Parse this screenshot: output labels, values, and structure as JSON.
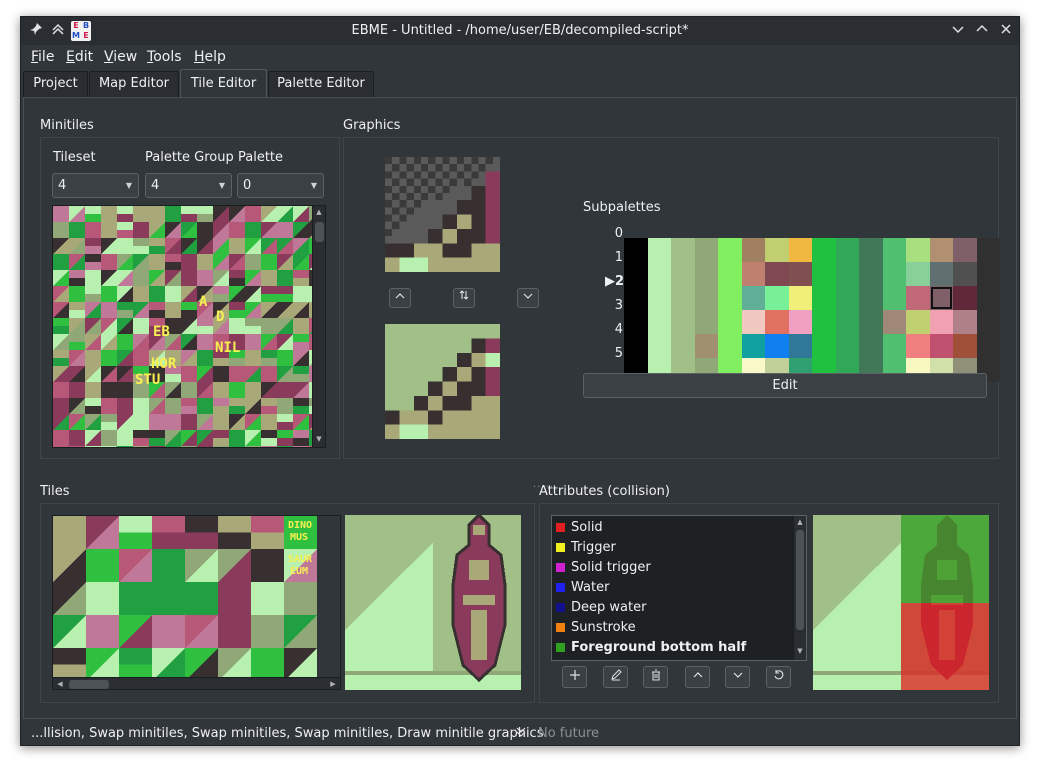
{
  "window": {
    "title": "EBME - Untitled - /home/user/EB/decompiled-script*",
    "logo_letters": [
      "E",
      "B",
      "M",
      "E"
    ]
  },
  "menu": [
    "File",
    "Edit",
    "View",
    "Tools",
    "Help"
  ],
  "menu_underline": [
    "F",
    "E",
    "V",
    "T",
    "H"
  ],
  "tabs": [
    "Project",
    "Map Editor",
    "Tile Editor",
    "Palette Editor"
  ],
  "active_tab": "Tile Editor",
  "minitiles": {
    "group_title": "Minitiles",
    "tileset_label": "Tileset",
    "tileset_value": "4",
    "palette_group_label": "Palette Group",
    "palette_group_value": "4",
    "palette_label": "Palette",
    "palette_value": "0",
    "overlay_text": [
      "A",
      "D",
      "EB",
      "NIL",
      "HOR",
      "STU"
    ]
  },
  "graphics": {
    "group_title": "Graphics",
    "buttons": [
      "up-icon",
      "swap-icon",
      "down-icon"
    ]
  },
  "subpalettes": {
    "title": "Subpalettes",
    "row_labels": [
      "0",
      "1",
      "2",
      "3",
      "4",
      "5"
    ],
    "selected_row": 2,
    "selected_col": 14,
    "rows": [
      [
        "#000000",
        "#b8f0b0",
        "#a0c088",
        "#90a878",
        "#80f060",
        "#a08060",
        "#c0d070",
        "#f0b840",
        "#20c040",
        "#30a858",
        "#407858",
        "#50c070",
        "#a8e080",
        "#b09070",
        "#806068",
        "#303030"
      ],
      [
        "#000000",
        "#b8f0b0",
        "#a0c088",
        "#90a878",
        "#80f060",
        "#c08070",
        "#804850",
        "#805050",
        "#20c040",
        "#30a858",
        "#407858",
        "#50c070",
        "#88d098",
        "#607070",
        "#505050",
        "#303030"
      ],
      [
        "#000000",
        "#b8f0b0",
        "#a0c088",
        "#90a878",
        "#80f060",
        "#60b098",
        "#78f098",
        "#f0f078",
        "#20c040",
        "#30a858",
        "#407858",
        "#50c070",
        "#c06878",
        "#806068",
        "#602838",
        "#303030"
      ],
      [
        "#000000",
        "#b8f0b0",
        "#a0c088",
        "#90a878",
        "#80f060",
        "#f0c8c0",
        "#e07060",
        "#f0a0c0",
        "#20c040",
        "#30a858",
        "#407858",
        "#a08878",
        "#c0d070",
        "#f0a0b0",
        "#b08088",
        "#303030"
      ],
      [
        "#000000",
        "#b8f0b0",
        "#a0c088",
        "#a09070",
        "#80f060",
        "#10a0a0",
        "#1080f0",
        "#307898",
        "#20c040",
        "#30a858",
        "#407858",
        "#50c070",
        "#f08080",
        "#c05070",
        "#a05038",
        "#303030"
      ],
      [
        "#000000",
        "#b8f0b0",
        "#a0c088",
        "#90a878",
        "#80f060",
        "#f8f8c8",
        "#c0d098",
        "#30a070",
        "#20c040",
        "#30a858",
        "#407858",
        "#50c070",
        "#f8f8c0",
        "#d0e0a8",
        "#909078",
        "#303030"
      ]
    ],
    "edit_label": "Edit"
  },
  "tiles": {
    "group_title": "Tiles",
    "overlay_text": [
      "DINO",
      "MUS",
      "SAUR",
      "EUM"
    ]
  },
  "attributes": {
    "group_title": "Attributes (collision)",
    "items": [
      {
        "label": "Solid",
        "color": "#e02020",
        "bold": false
      },
      {
        "label": "Trigger",
        "color": "#f0f020",
        "bold": false
      },
      {
        "label": "Solid trigger",
        "color": "#d020d0",
        "bold": false
      },
      {
        "label": "Water",
        "color": "#2020f0",
        "bold": false
      },
      {
        "label": "Deep water",
        "color": "#10108a",
        "bold": false
      },
      {
        "label": "Sunstroke",
        "color": "#f08010",
        "bold": false
      },
      {
        "label": "Foreground bottom half",
        "color": "#30a020",
        "bold": true
      }
    ],
    "buttons": [
      "add-icon",
      "edit-icon",
      "delete-icon",
      "move-up-icon",
      "move-down-icon",
      "reset-icon"
    ]
  },
  "status": {
    "history": "...llision, Swap minitiles, Swap minitiles, Swap minitiles, Draw minitile graphics",
    "future": "No future"
  },
  "colors": {
    "bg": "#31363b",
    "tile_dark": "#383030",
    "tile_mauve": "#8a3a5a",
    "tile_olive": "#a8a878",
    "tile_light": "#b8f0b0",
    "tile_green": "#30c040"
  }
}
